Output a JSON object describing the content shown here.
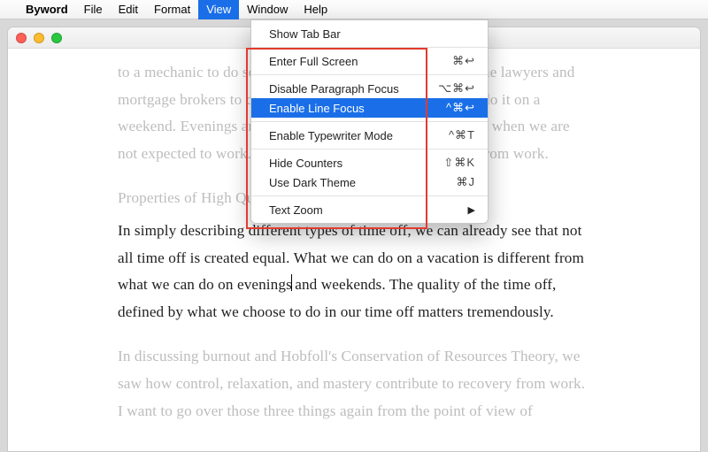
{
  "menubar": {
    "appname": "Byword",
    "items": [
      "File",
      "Edit",
      "Format",
      "View",
      "Window",
      "Help"
    ],
    "open_index": 3
  },
  "menu": {
    "show_tab_bar": "Show Tab Bar",
    "enter_full_screen": "Enter Full Screen",
    "enter_full_screen_sc": "⌘↩",
    "disable_para_focus": "Disable Paragraph Focus",
    "disable_para_focus_sc": "⌥⌘↩",
    "enable_line_focus": "Enable Line Focus",
    "enable_line_focus_sc": "^⌘↩",
    "enable_typewriter": "Enable Typewriter Mode",
    "enable_typewriter_sc": "^⌘T",
    "hide_counters": "Hide Counters",
    "hide_counters_sc": "⇧⌘K",
    "dark_theme": "Use Dark Theme",
    "dark_theme_sc": "⌘J",
    "text_zoom": "Text Zoom"
  },
  "doc": {
    "p1a": "to a mechanic to do something to a car. Just try getting all the lawyers and mortgage brokers to come in on the final sale of a home to do it on a weekend. Evenings and holidays are, for the most part, time when we are not expected to work. We're not getting an adequate break from work.",
    "heading_dim": "Properties of High Quality Time Off",
    "p2a": "In simply describing different types of time off, we can already see that not all time off is created equal. What we can do on a vacation is different from what we can do on evenings",
    "p2b": " and weekends. The quality of the time off, defined by what we choose to do in our time off matters tremendously.",
    "p3": "In discussing burnout and Hobfoll's Conservation of Resources Theory, we saw how control, relaxation, and mastery contribute to recovery from work. I want to go over those three things again from the point of view of"
  }
}
